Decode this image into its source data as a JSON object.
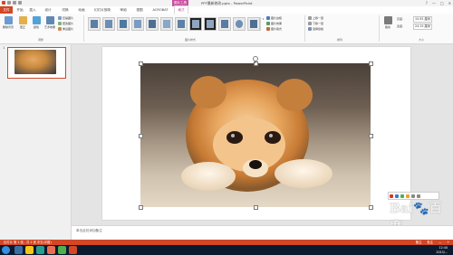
{
  "titlebar": {
    "picture_tools_label": "图片工具",
    "document_title": "PPT最新修改.pptx - PowerPoint",
    "win_buttons": [
      "?",
      "—",
      "□",
      "✕"
    ]
  },
  "tabs": {
    "items": [
      {
        "label": "文件"
      },
      {
        "label": "开始"
      },
      {
        "label": "插入"
      },
      {
        "label": "设计"
      },
      {
        "label": "切换"
      },
      {
        "label": "动画"
      },
      {
        "label": "幻灯片放映"
      },
      {
        "label": "审阅"
      },
      {
        "label": "视图"
      },
      {
        "label": "ACROBAT"
      },
      {
        "label": "格式"
      }
    ]
  },
  "ribbon": {
    "adjust": {
      "remove_bg": "删除背景",
      "corrections": "更正",
      "color": "颜色",
      "artistic": "艺术效果",
      "compress": "压缩图片",
      "change": "更改图片",
      "reset": "重设图片",
      "group_label": "调整"
    },
    "styles": {
      "group_label": "图片样式"
    },
    "style_options": {
      "border": "图片边框",
      "effects": "图片效果",
      "layout": "图片版式"
    },
    "arrange": {
      "bring_forward": "上移一层",
      "send_backward": "下移一层",
      "selection_pane": "选择窗格",
      "group_label": "排列"
    },
    "size": {
      "crop": "裁剪",
      "height_label": "高度:",
      "height_value": "15.92 厘米",
      "width_label": "宽度:",
      "width_value": "24.15 厘米",
      "group_label": "大小"
    }
  },
  "slides_panel": {
    "slide_number": "1"
  },
  "notes": {
    "placeholder": "单击此处添加备注"
  },
  "statusbar": {
    "left": "幻灯片 第 1 张，共 1 张    中文(中国)",
    "right": [
      "备注",
      "批注",
      "—",
      "+"
    ]
  },
  "watermark": {
    "logo": "Bai🐾百度",
    "sub": "jingyan.baidu.com"
  },
  "taskbar": {
    "time": "12:40",
    "date": "2015/..."
  }
}
